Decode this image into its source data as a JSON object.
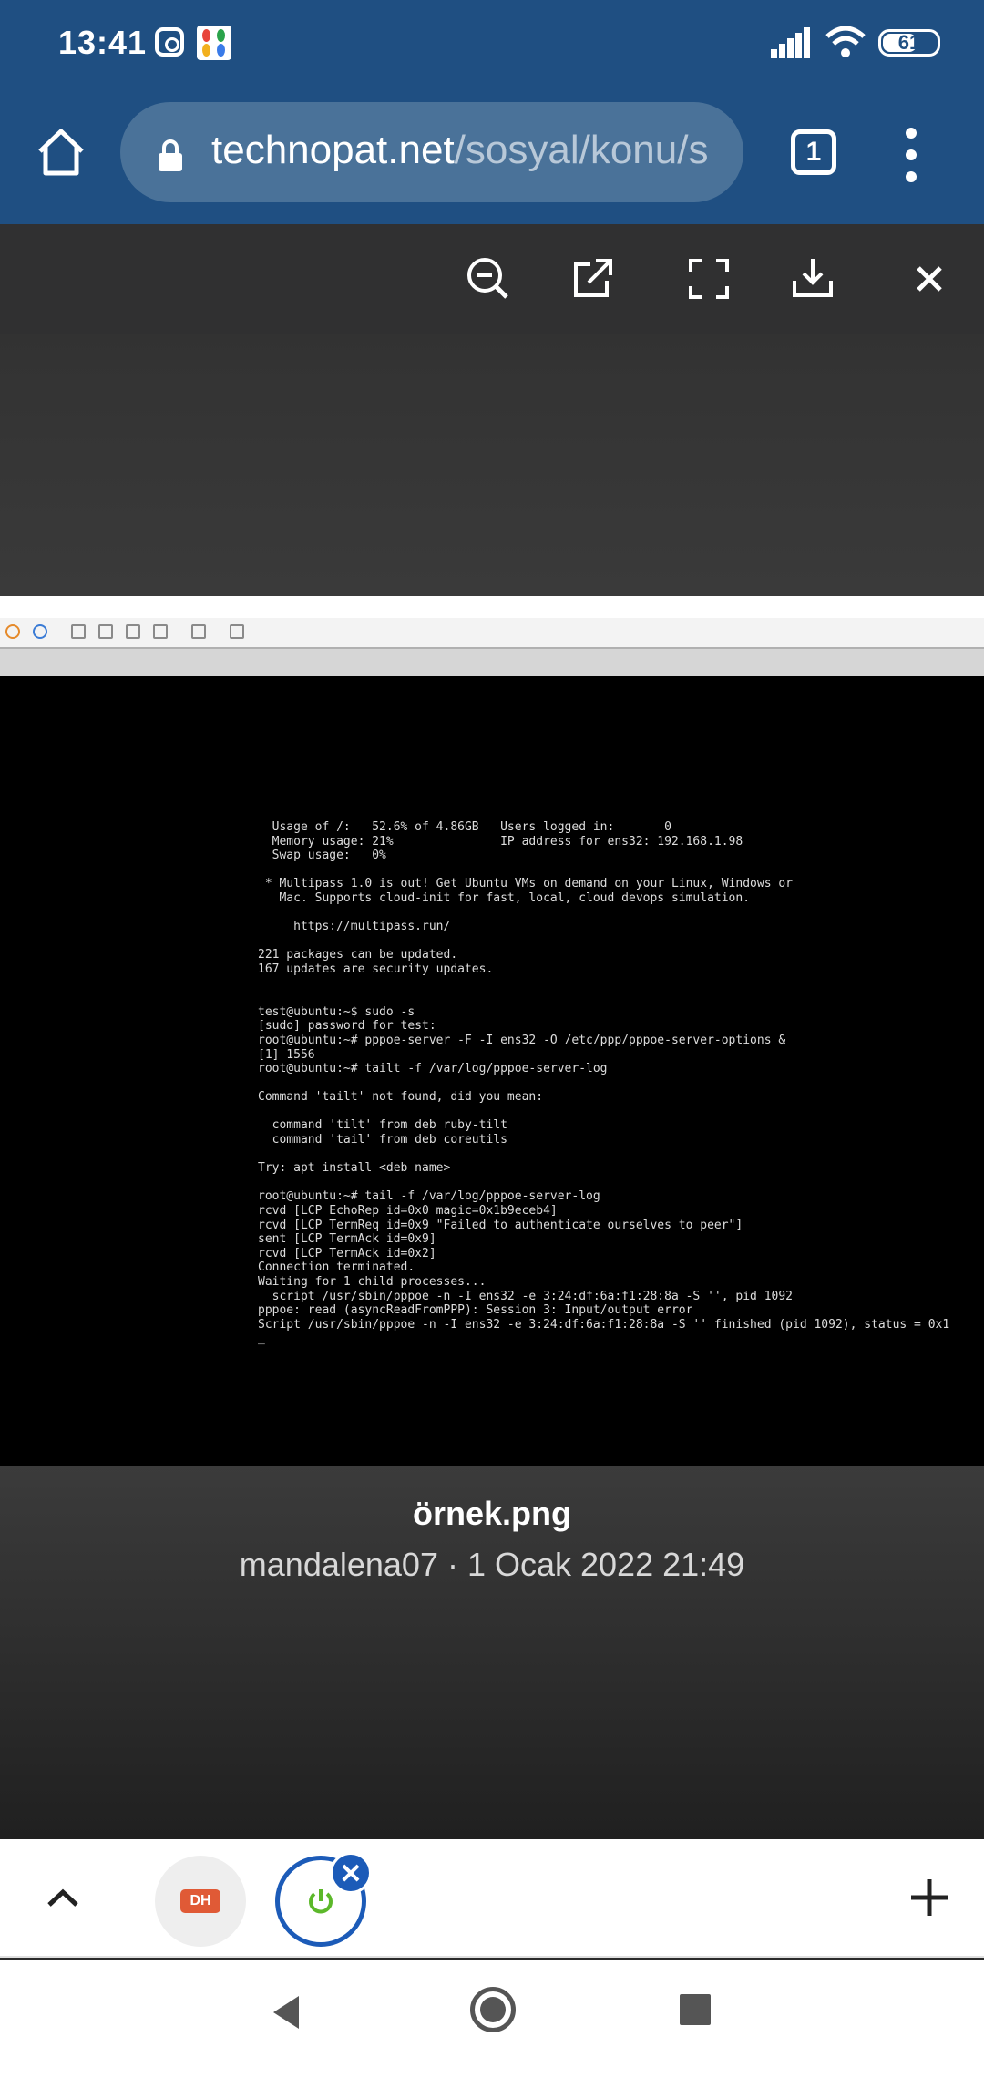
{
  "status_bar": {
    "time": "13:41",
    "battery": "61",
    "icons": [
      "instagram-icon",
      "app-notification-icon",
      "signal-icon",
      "wifi-icon",
      "battery-icon"
    ]
  },
  "browser": {
    "url_domain": "technopat.net",
    "url_path": "/sosyal/konu/s",
    "tab_count": "1",
    "colors": {
      "toolbar": "#1f4f82",
      "urlbar": "#4a7299"
    }
  },
  "viewer": {
    "toolbar_icons": [
      "zoom-out-icon",
      "open-external-icon",
      "fullscreen-icon",
      "download-icon",
      "close-icon"
    ],
    "caption_title": "örnek.png",
    "caption_meta": "mandalena07 · 1 Ocak 2022 21:49"
  },
  "terminal": {
    "lines": [
      "  Usage of /:   52.6% of 4.86GB   Users logged in:       0",
      "  Memory usage: 21%               IP address for ens32: 192.168.1.98",
      "  Swap usage:   0%",
      "",
      " * Multipass 1.0 is out! Get Ubuntu VMs on demand on your Linux, Windows or",
      "   Mac. Supports cloud-init for fast, local, cloud devops simulation.",
      "",
      "     https://multipass.run/",
      "",
      "221 packages can be updated.",
      "167 updates are security updates.",
      "",
      "",
      "test@ubuntu:~$ sudo -s",
      "[sudo] password for test:",
      "root@ubuntu:~# pppoe-server -F -I ens32 -O /etc/ppp/pppoe-server-options &",
      "[1] 1556",
      "root@ubuntu:~# tailt -f /var/log/pppoe-server-log",
      "",
      "Command 'tailt' not found, did you mean:",
      "",
      "  command 'tilt' from deb ruby-tilt",
      "  command 'tail' from deb coreutils",
      "",
      "Try: apt install <deb name>",
      "",
      "root@ubuntu:~# tail -f /var/log/pppoe-server-log",
      "rcvd [LCP EchoRep id=0x0 magic=0x1b9eceb4]",
      "rcvd [LCP TermReq id=0x9 \"Failed to authenticate ourselves to peer\"]",
      "sent [LCP TermAck id=0x9]",
      "rcvd [LCP TermAck id=0x2]",
      "Connection terminated.",
      "Waiting for 1 child processes...",
      "  script /usr/sbin/pppoe -n -I ens32 -e 3:24:df:6a:f1:28:8a -S '', pid 1092",
      "pppoe: read (asyncReadFromPPP): Session 3: Input/output error",
      "Script /usr/sbin/pppoe -n -I ens32 -e 3:24:df:6a:f1:28:8a -S '' finished (pid 1092), status = 0x1",
      "_"
    ]
  },
  "bottom_bar": {
    "inactive_tab_label": "DH",
    "active_tab_close": "✕"
  }
}
